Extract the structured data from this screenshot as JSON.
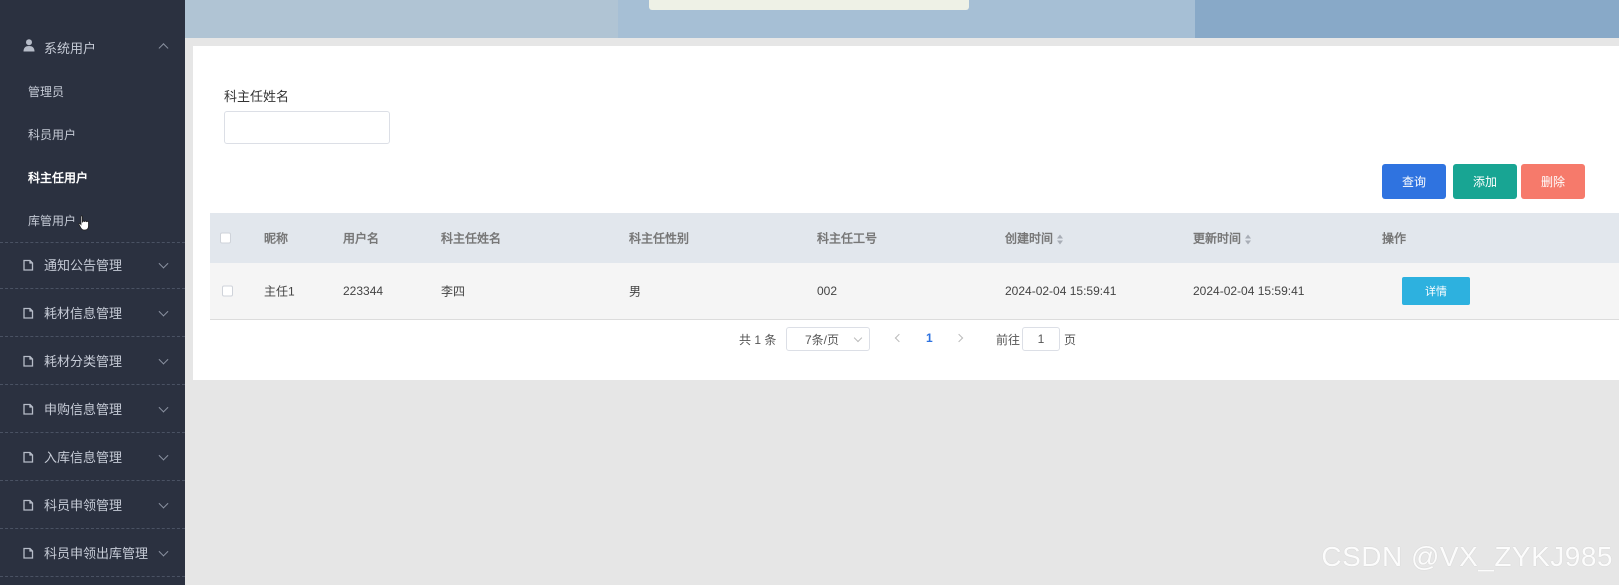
{
  "sidebar": {
    "groups": [
      {
        "label": "系统用户",
        "icon": "user-icon",
        "expanded": true
      },
      {
        "label": "通知公告管理",
        "icon": "document-icon"
      },
      {
        "label": "耗材信息管理",
        "icon": "document-icon"
      },
      {
        "label": "耗材分类管理",
        "icon": "document-icon"
      },
      {
        "label": "申购信息管理",
        "icon": "document-icon"
      },
      {
        "label": "入库信息管理",
        "icon": "document-icon"
      },
      {
        "label": "科员申领管理",
        "icon": "document-icon"
      },
      {
        "label": "科员申领出库管理",
        "icon": "document-icon"
      }
    ],
    "subitems": [
      {
        "label": "管理员"
      },
      {
        "label": "科员用户"
      },
      {
        "label": "科主任用户",
        "active": true
      },
      {
        "label": "库管用户"
      }
    ]
  },
  "search": {
    "label": "科主任姓名",
    "value": "",
    "placeholder": ""
  },
  "actions": {
    "query": "查询",
    "add": "添加",
    "delete": "删除"
  },
  "table": {
    "headers": [
      "昵称",
      "用户名",
      "科主任姓名",
      "科主任性别",
      "科主任工号",
      "创建时间",
      "更新时间",
      "操作"
    ],
    "rows": [
      {
        "nickname": "主任1",
        "username": "223344",
        "name": "李四",
        "gender": "男",
        "job_no": "002",
        "created": "2024-02-04 15:59:41",
        "updated": "2024-02-04 15:59:41",
        "action": "详情"
      }
    ]
  },
  "pagination": {
    "total_text": "共 1 条",
    "page_size": "7条/页",
    "current_page": "1",
    "goto_label": "前往",
    "goto_value": "1",
    "page_unit": "页"
  },
  "watermark": "CSDN @VX_ZYKJ985",
  "colors": {
    "sidebar_bg": "#2b3140",
    "query_button": "#2f73e0",
    "add_button": "#18a593",
    "delete_button": "#f67a6b",
    "detail_button": "#2db1df"
  }
}
